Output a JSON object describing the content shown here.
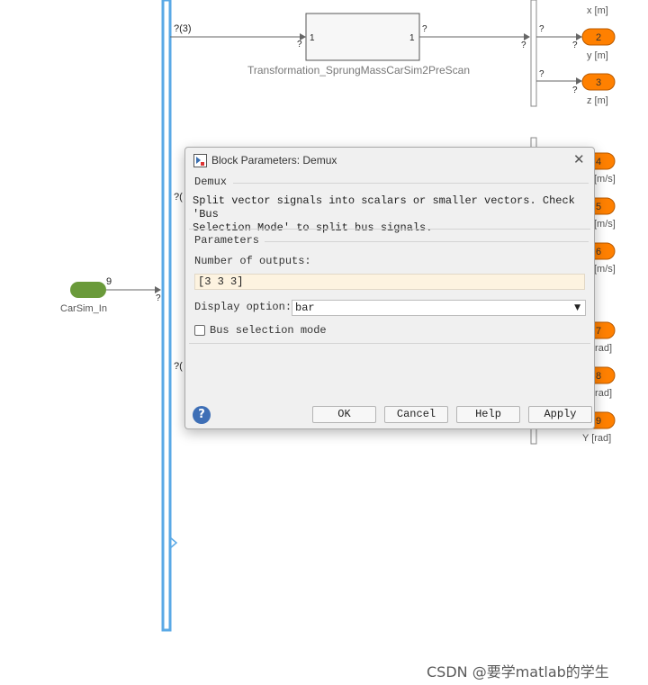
{
  "diagram": {
    "transform_block_name": "Transformation_SprungMassCarSim2PreScan",
    "transform_in_port": "1",
    "transform_out_port": "1",
    "input_dim": "?(3)",
    "input_dim_mid": "?(",
    "input_dim_low": "?(",
    "unknown": "?",
    "inport_label": "CarSim_In",
    "inport_dim": "9",
    "outports": [
      {
        "number": "2",
        "label": "y [m]"
      },
      {
        "number": "3",
        "label": "z [m]"
      },
      {
        "number": "4",
        "label": "[m/s]"
      },
      {
        "number": "5",
        "label": "[m/s]"
      },
      {
        "number": "6",
        "label": "[m/s]"
      },
      {
        "number": "7",
        "label": "[rad]"
      },
      {
        "number": "8",
        "label": "[rad]"
      },
      {
        "number": "9",
        "label": "Y [rad]"
      }
    ],
    "top_outport_label": "x [m]"
  },
  "dialog": {
    "title": "Block Parameters: Demux",
    "section_block": "Demux",
    "description": "Split vector signals into scalars or smaller vectors. Check 'Bus\nSelection Mode' to split bus signals.",
    "section_params": "Parameters",
    "num_outputs_label": "Number of outputs:",
    "num_outputs_value": "[3 3 3]",
    "display_option_label": "Display option:",
    "display_option_value": "bar",
    "bus_selection_label": "Bus selection mode",
    "bus_selection_checked": false,
    "buttons": {
      "ok": "OK",
      "cancel": "Cancel",
      "help": "Help",
      "apply": "Apply"
    },
    "help_icon": "?"
  },
  "watermark": "CSDN @要学matlab的学生",
  "colors": {
    "bus_bar": "#5aa9e6",
    "outport": "#ff8000",
    "inport": "#6a9a3a"
  }
}
